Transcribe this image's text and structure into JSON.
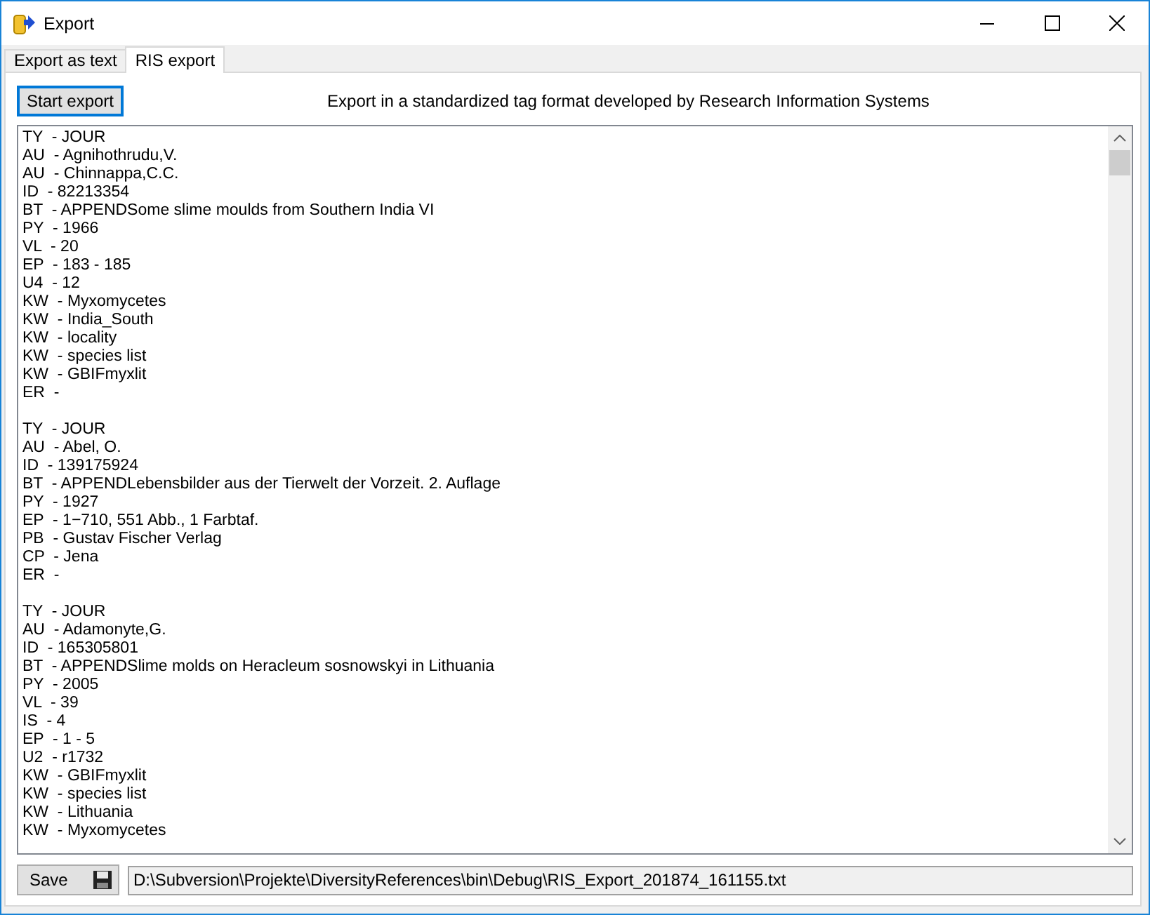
{
  "window": {
    "title": "Export"
  },
  "tabs": [
    {
      "label": "Export as text",
      "selected": false
    },
    {
      "label": "RIS export",
      "selected": true
    }
  ],
  "start_button": {
    "label": "Start export",
    "focused": true
  },
  "description": "Export in a standardized tag format developed by Research Information Systems",
  "records": [
    {
      "lines": [
        "TY  - JOUR",
        "AU  - Agnihothrudu,V.",
        "AU  - Chinnappa,C.C.",
        "ID  - 82213354",
        "BT  - APPENDSome slime moulds from Southern India VI",
        "PY  - 1966",
        "VL  - 20",
        "EP  - 183 - 185",
        "U4  - 12",
        "KW  - Myxomycetes",
        "KW  - India_South",
        "KW  - locality",
        "KW  - species list",
        "KW  - GBIFmyxlit",
        "ER  -"
      ]
    },
    {
      "lines": [
        "TY  - JOUR",
        "AU  - Abel, O.",
        "ID  - 139175924",
        "BT  - APPENDLebensbilder aus der Tierwelt der Vorzeit. 2. Auflage",
        "PY  - 1927",
        "EP  - 1−710, 551 Abb., 1 Farbtaf.",
        "PB  - Gustav Fischer Verlag",
        "CP  - Jena",
        "ER  -"
      ]
    },
    {
      "lines": [
        "TY  - JOUR",
        "AU  - Adamonyte,G.",
        "ID  - 165305801",
        "BT  - APPENDSlime molds on Heracleum sosnowskyi in Lithuania",
        "PY  - 2005",
        "VL  - 39",
        "IS  - 4",
        "EP  - 1 - 5",
        "U2  - r1732",
        "KW  - GBIFmyxlit",
        "KW  - species list",
        "KW  - Lithuania",
        "KW  - Myxomycetes"
      ]
    }
  ],
  "save_button": {
    "label": "Save"
  },
  "file_path": {
    "value": "D:\\Subversion\\Projekte\\DiversityReferences\\bin\\Debug\\RIS_Export_201874_161155.txt"
  }
}
